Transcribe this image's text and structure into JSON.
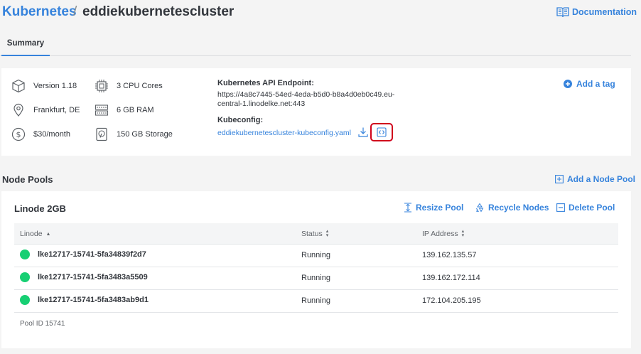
{
  "breadcrumb": {
    "root": "Kubernetes",
    "separator": "/",
    "title": "eddiekubernetescluster"
  },
  "header": {
    "docs_label": "Documentation"
  },
  "tabs": [
    {
      "label": "Summary"
    }
  ],
  "summary": {
    "version": "Version 1.18",
    "region": "Frankfurt, DE",
    "price": "$30/month",
    "cpu": "3 CPU Cores",
    "ram": "6 GB RAM",
    "storage": "150 GB Storage",
    "api_label": "Kubernetes API Endpoint:",
    "api_endpoint": "https://4a8c7445-54ed-4eda-b5d0-b8a4d0eb0c49.eu-central-1.linodelke.net:443",
    "kubeconfig_label": "Kubeconfig:",
    "kubeconfig_file": "eddiekubernetescluster-kubeconfig.yaml",
    "add_tag_label": "Add a tag"
  },
  "node_pools": {
    "title": "Node Pools",
    "add_label": "Add a Node Pool",
    "pool": {
      "title": "Linode 2GB",
      "resize_label": "Resize Pool",
      "recycle_label": "Recycle Nodes",
      "delete_label": "Delete Pool",
      "columns": [
        "Linode",
        "Status",
        "IP Address"
      ],
      "rows": [
        {
          "name": "lke12717-15741-5fa34839f2d7",
          "status": "Running",
          "ip": "139.162.135.57"
        },
        {
          "name": "lke12717-15741-5fa3483a5509",
          "status": "Running",
          "ip": "139.162.172.114"
        },
        {
          "name": "lke12717-15741-5fa3483ab9d1",
          "status": "Running",
          "ip": "172.104.205.195"
        }
      ],
      "pool_id": "Pool ID 15741"
    }
  },
  "colors": {
    "accent": "#3683dc",
    "running": "#17cf73",
    "highlight": "#d0021b"
  }
}
